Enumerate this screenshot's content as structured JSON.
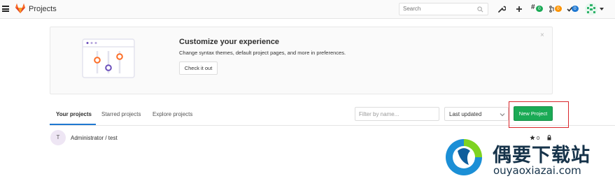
{
  "header": {
    "title": "Projects",
    "search_placeholder": "Search",
    "counters": {
      "issues": "0",
      "merge_requests": "0",
      "todos": "0"
    }
  },
  "banner": {
    "title": "Customize your experience",
    "text": "Change syntax themes, default project pages, and more in preferences.",
    "button_label": "Check it out",
    "close": "×"
  },
  "tabs": [
    {
      "label": "Your projects",
      "active": true
    },
    {
      "label": "Starred projects",
      "active": false
    },
    {
      "label": "Explore projects",
      "active": false
    }
  ],
  "filter": {
    "placeholder": "Filter by name..."
  },
  "sort": {
    "selected": "Last updated"
  },
  "new_project_label": "New Project",
  "projects": [
    {
      "avatar_letter": "T",
      "name": "Administrator / test",
      "stars": "0",
      "visibility": "private"
    }
  ],
  "watermark": {
    "title": "偶要下载站",
    "url": "ouyaoxiazai.com"
  },
  "colors": {
    "accent_blue": "#1f78d1",
    "success_green": "#1aaa55",
    "highlight_red": "#d9262b",
    "counter_green": "#1aaa55",
    "counter_orange": "#fc9403",
    "counter_blue": "#1f78d1"
  }
}
